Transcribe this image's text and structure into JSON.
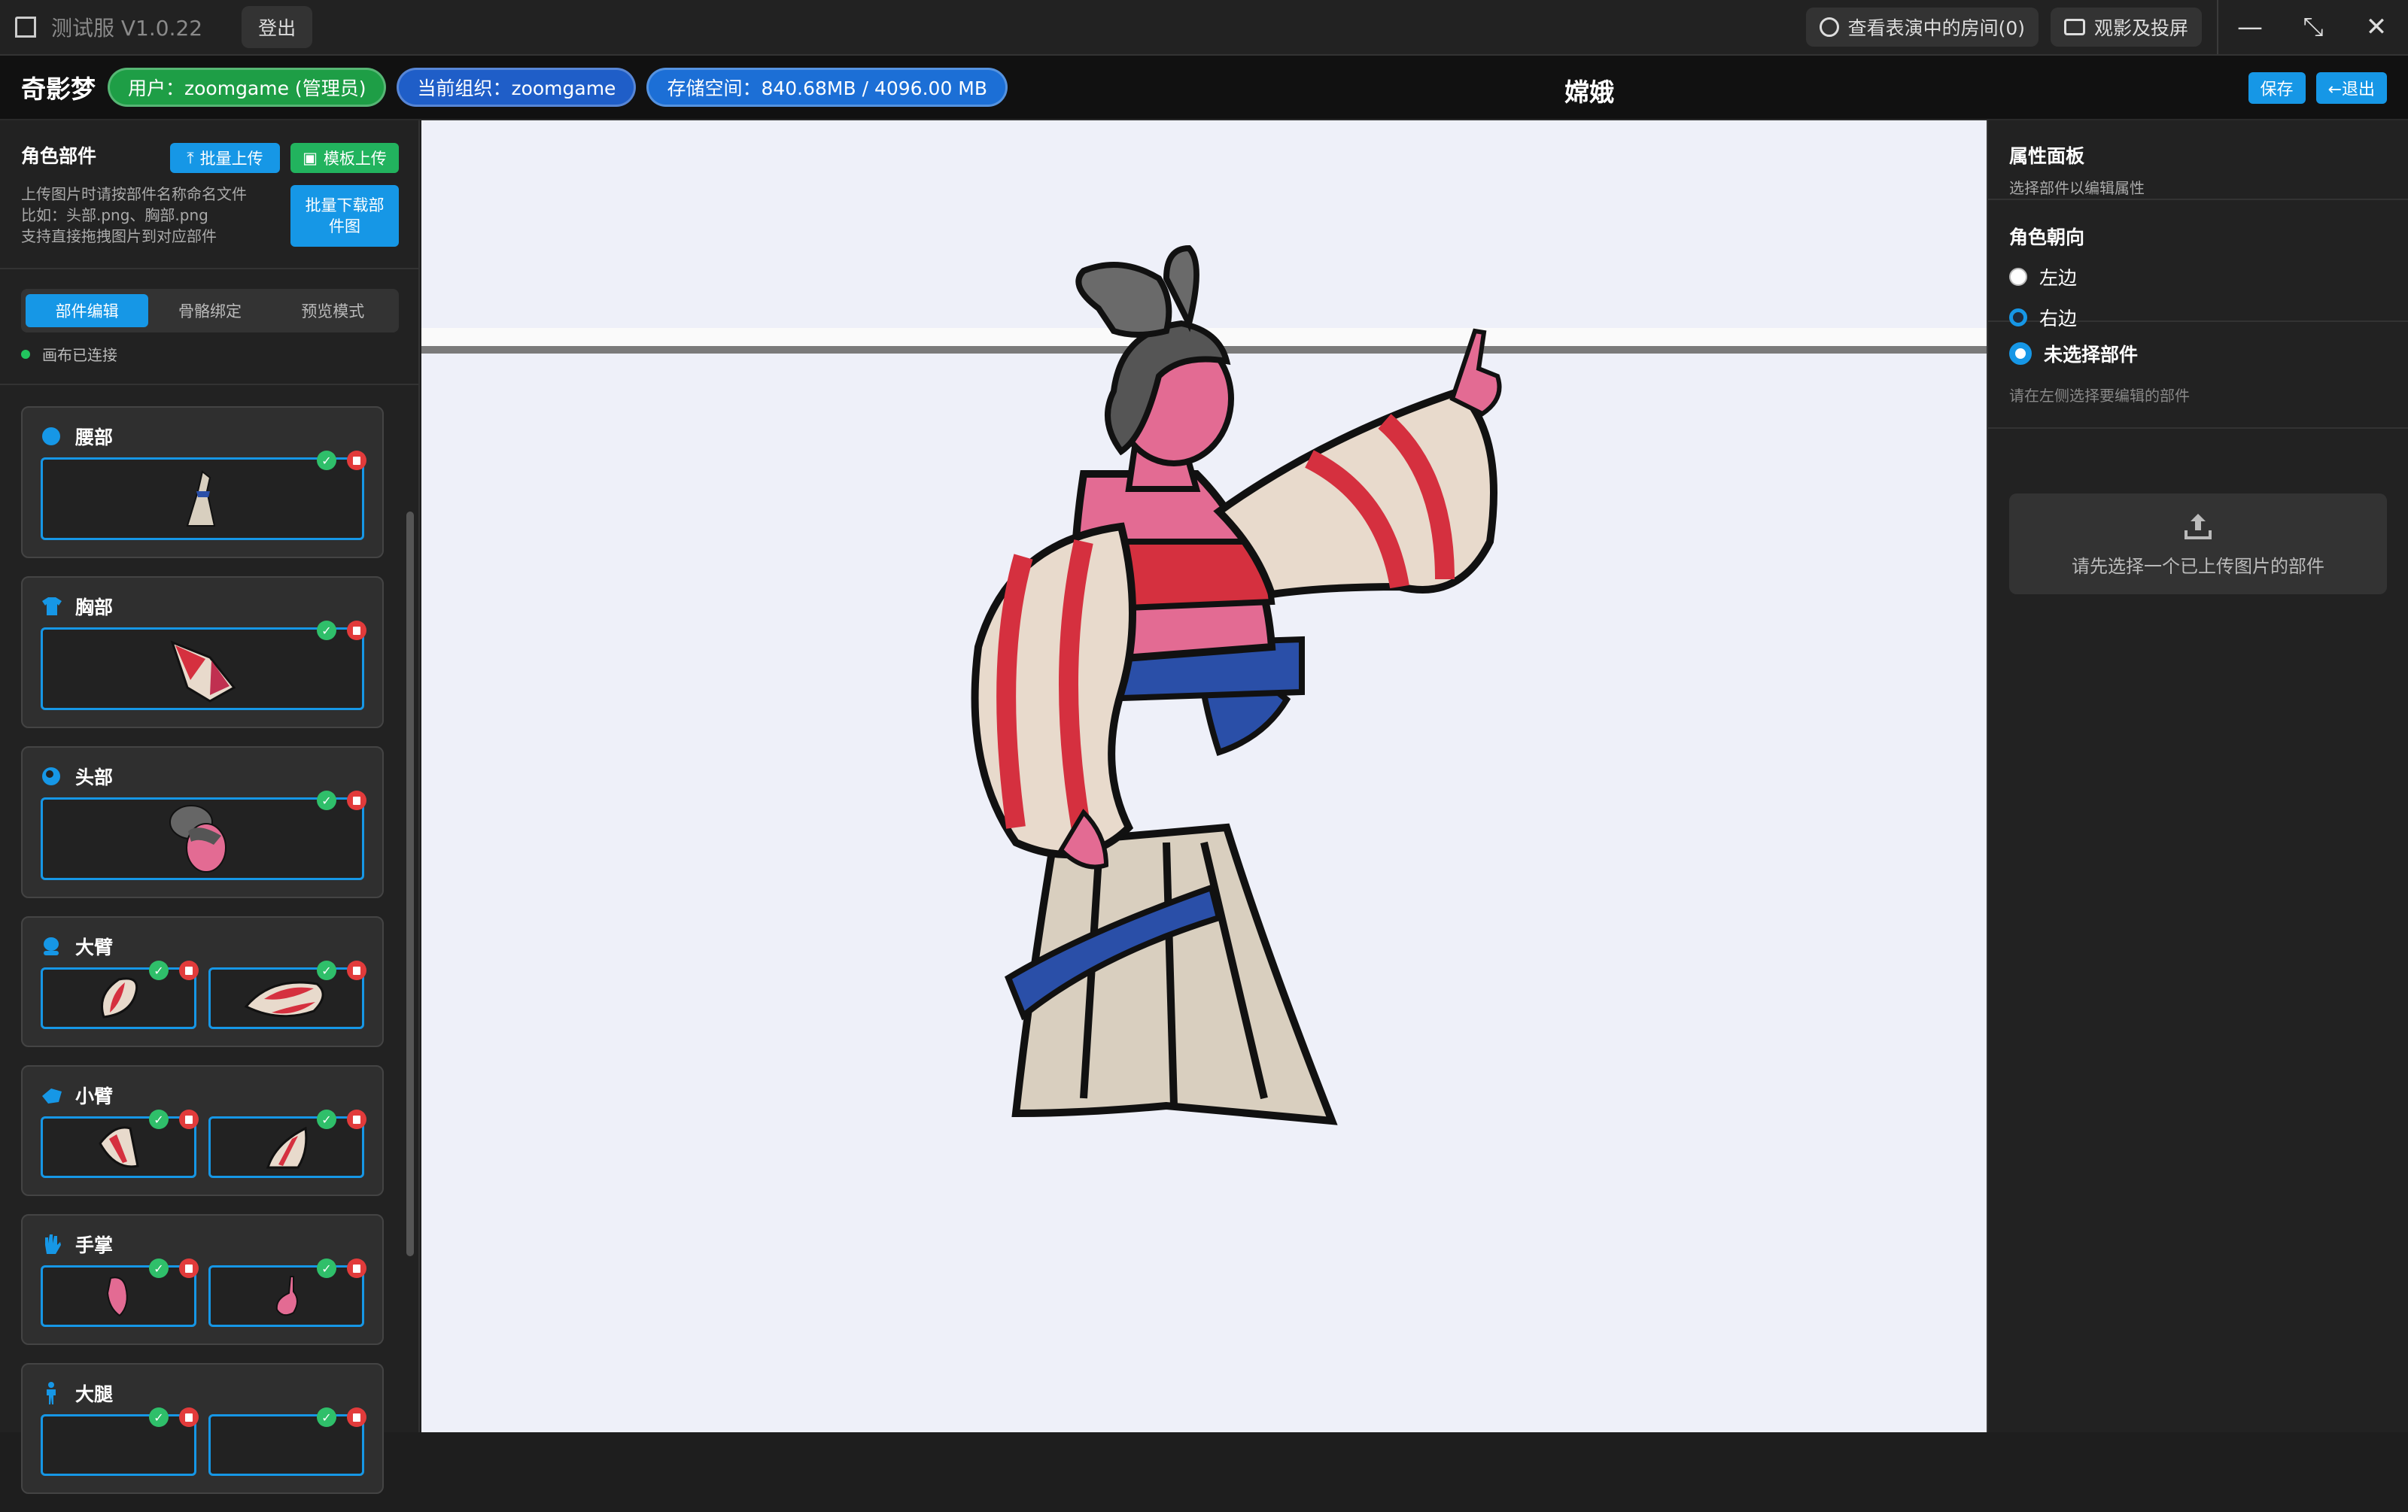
{
  "titlebar": {
    "app_title": "测试服 V1.0.22",
    "logout_label": "登出",
    "rooms_label": "查看表演中的房间(0)",
    "cast_label": "观影及投屏",
    "minimize": "—",
    "restore": "⤡",
    "close": "✕"
  },
  "header": {
    "brand": "奇影梦",
    "user_pill": "用户：zoomgame (管理员)",
    "org_pill": "当前组织：zoomgame",
    "storage_pill": "存储空间：840.68MB / 4096.00 MB",
    "title": "嫦娥",
    "save_label": "保存",
    "exit_label": "←退出"
  },
  "left_panel": {
    "title": "角色部件",
    "batch_upload": "批量上传",
    "template_upload": "模板上传",
    "batch_download": "批量下载部件图",
    "hint_lines": [
      "上传图片时请按部件名称命名文件",
      "比如：头部.png、胸部.png",
      "支持直接拖拽图片到对应部件"
    ],
    "tabs": [
      "部件编辑",
      "骨骼绑定",
      "预览模式"
    ],
    "active_tab": 0,
    "status": "画布已连接",
    "parts": [
      {
        "name": "腰部",
        "icon": "circle-icon",
        "slots": 1
      },
      {
        "name": "胸部",
        "icon": "shirt-icon",
        "slots": 1
      },
      {
        "name": "头部",
        "icon": "head-icon",
        "slots": 1
      },
      {
        "name": "大臂",
        "icon": "arm-icon",
        "slots": 2
      },
      {
        "name": "小臂",
        "icon": "forearm-icon",
        "slots": 2
      },
      {
        "name": "手掌",
        "icon": "hand-icon",
        "slots": 2
      },
      {
        "name": "大腿",
        "icon": "leg-icon",
        "slots": 2
      }
    ]
  },
  "right_panel": {
    "title": "属性面板",
    "subtitle": "选择部件以编辑属性",
    "facing_title": "角色朝向",
    "facing_options": [
      "左边",
      "右边"
    ],
    "facing_selected": 1,
    "no_selection_label": "未选择部件",
    "no_selection_hint": "请在左侧选择要编辑的部件",
    "upload_hint": "请先选择一个已上传图片的部件"
  },
  "colors": {
    "accent": "#1697e6",
    "success": "#22b35e",
    "danger": "#e23b3b"
  }
}
